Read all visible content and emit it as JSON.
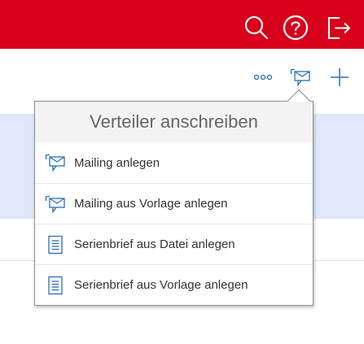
{
  "header": {
    "icons": [
      "search-icon",
      "help-icon",
      "logout-icon"
    ],
    "background_color": "#d8001a"
  },
  "toolbar": {
    "icons": [
      "more-icon",
      "mailing-icon",
      "add-icon"
    ],
    "accent_color": "#2a6ebb"
  },
  "popover": {
    "title": "Verteiler anschreiben",
    "items": [
      {
        "label": "Mailing anlegen",
        "icon": "mailing-icon"
      },
      {
        "label": "Mailing aus Vorlage anlegen",
        "icon": "mailing-icon"
      },
      {
        "label": "Serienbrief aus Datei anlegen",
        "icon": "document-icon"
      },
      {
        "label": "Serienbrief aus Vorlage anlegen",
        "icon": "document-icon"
      }
    ]
  }
}
